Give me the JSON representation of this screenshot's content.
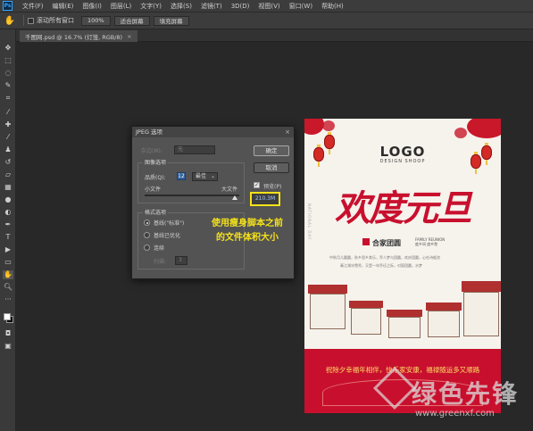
{
  "app": {
    "logo": "Ps"
  },
  "menubar": {
    "items": [
      "文件(F)",
      "编辑(E)",
      "图像(I)",
      "图层(L)",
      "文字(Y)",
      "选择(S)",
      "滤镜(T)",
      "3D(D)",
      "视图(V)",
      "窗口(W)",
      "帮助(H)"
    ]
  },
  "options": {
    "scroll_all_label": "滚动所有窗口",
    "zoom_btn": "100%",
    "fit_btn": "适合屏幕",
    "fill_btn": "填充屏幕"
  },
  "document": {
    "tab_title": "千图网.psd @ 16.7% (灯笼, RGB/8)",
    "tab_close": "×"
  },
  "dialog": {
    "title": "JPEG 选项",
    "matte_label": "杂边(M):",
    "matte_value": "无",
    "image_options_title": "图像选项",
    "quality_label": "品质(Q):",
    "quality_value": "12",
    "quality_level": "最佳",
    "small_file": "小文件",
    "large_file": "大文件",
    "slider_position": 0.95,
    "format_options_title": "格式选项",
    "format_baseline_standard": "基线(\"标准\")",
    "format_baseline_optimized": "基线已优化",
    "format_progressive": "连续",
    "scans_label": "扫描:",
    "scans_value": "3",
    "ok_button": "确定",
    "cancel_button": "取消",
    "preview_label": "预览(P)",
    "preview_checked": true,
    "file_size": "210.3M",
    "close_glyph": "×"
  },
  "annotation": {
    "line1": "使用瘦身脚本之前",
    "line2": "的文件体积大小",
    "color": "#f5e21a"
  },
  "poster": {
    "logo": "LOGO",
    "logo_sub": "DESIGN SHOOP",
    "title": "欢度元旦",
    "vertical_text": "NATIONAL DAY",
    "reunion": "合家团圆",
    "reunion_en_1": "FAMILY REUNION",
    "reunion_en_2": "度乡间 度乡愁",
    "blessing_1": "中秋月儿圆圆，秋乡思乡其乐，乔人梦与团圆，欢庆团圆，心在诗般浓",
    "blessing_2": "秦江湖冰雪秀，又是一年乔迁之际，对面团圆，水梦",
    "band_text": "祝除夕幸福年相伴，快乐家安康，福禄随运多又顺路",
    "accent_red": "#c8102e"
  },
  "watermark": {
    "name": "绿色先锋",
    "url": "www.greenxf.com"
  }
}
